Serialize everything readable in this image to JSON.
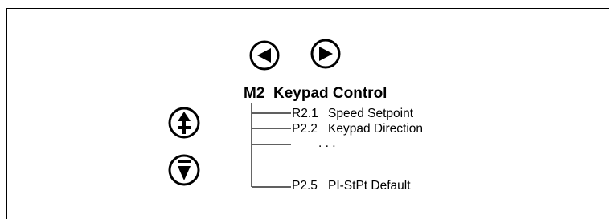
{
  "menu": {
    "code": "M2",
    "title": "Keypad Control",
    "items": [
      {
        "code": "R2.1",
        "label": "Speed Setpoint"
      },
      {
        "code": "P2.2",
        "label": "Keypad Direction"
      },
      {
        "code": "",
        "label": ". . ."
      },
      {
        "code": "P2.5",
        "label": "PI-StPt Default"
      }
    ]
  },
  "icons": {
    "left": "arrow-left-icon",
    "right": "arrow-right-icon",
    "up_plus": "arrow-up-plus-icon",
    "down_minus": "arrow-down-minus-icon"
  }
}
